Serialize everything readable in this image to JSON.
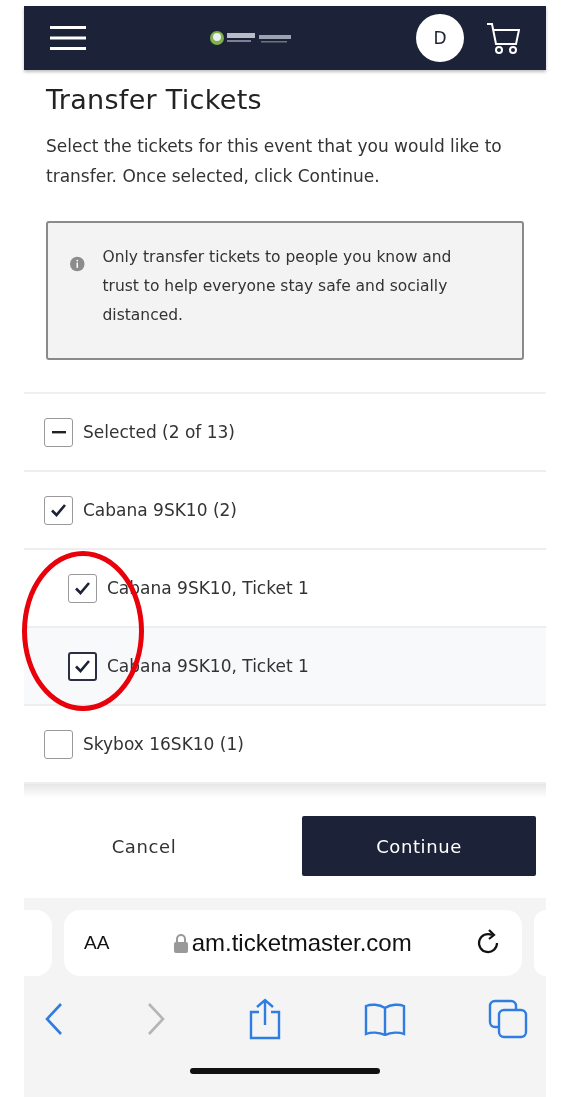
{
  "header": {
    "avatar_initial": "D"
  },
  "page": {
    "title": "Transfer Tickets",
    "description": "Select the tickets for this event that you would like to transfer. Once selected, click Continue."
  },
  "notice": {
    "text": "Only transfer tickets to people you know and trust to help everyone stay safe and socially distanced."
  },
  "selection": {
    "label": "Selected (2 of 13)",
    "indeterminate": true
  },
  "groups": [
    {
      "label": "Cabana 9SK10 (2)",
      "checked": true,
      "children": [
        {
          "label": "Cabana 9SK10, Ticket 1",
          "checked": true,
          "focused": false
        },
        {
          "label": "Cabana 9SK10, Ticket 1",
          "checked": true,
          "focused": true
        }
      ]
    },
    {
      "label": "Skybox 16SK10 (1)",
      "checked": false
    }
  ],
  "buttons": [
    {
      "label": "Cancel",
      "kind": "secondary"
    },
    {
      "label": "Continue",
      "kind": "primary"
    }
  ],
  "browser": {
    "text_size": "AA",
    "url": "am.ticketmaster.com",
    "forward_disabled": true
  }
}
